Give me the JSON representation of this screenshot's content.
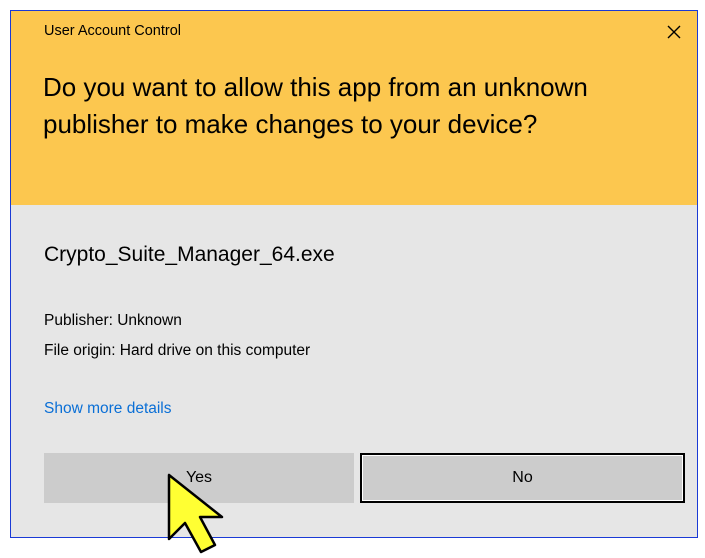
{
  "dialog": {
    "title": "User Account Control",
    "question": "Do you want to allow this app from an unknown publisher to make changes to your device?",
    "app_name": "Crypto_Suite_Manager_64.exe",
    "publisher": "Publisher: Unknown",
    "file_origin": "File origin: Hard drive on this computer",
    "details_link": "Show more details",
    "yes_label": "Yes",
    "no_label": "No"
  },
  "icons": {
    "close": "close-icon",
    "cursor": "mouse-pointer-icon"
  },
  "colors": {
    "header_bg": "#fcc74f",
    "body_bg": "#e6e6e6",
    "link": "#0a6fd6",
    "button_bg": "#cccccc",
    "border": "#1a3ad6",
    "cursor_fill": "#ffff33"
  }
}
